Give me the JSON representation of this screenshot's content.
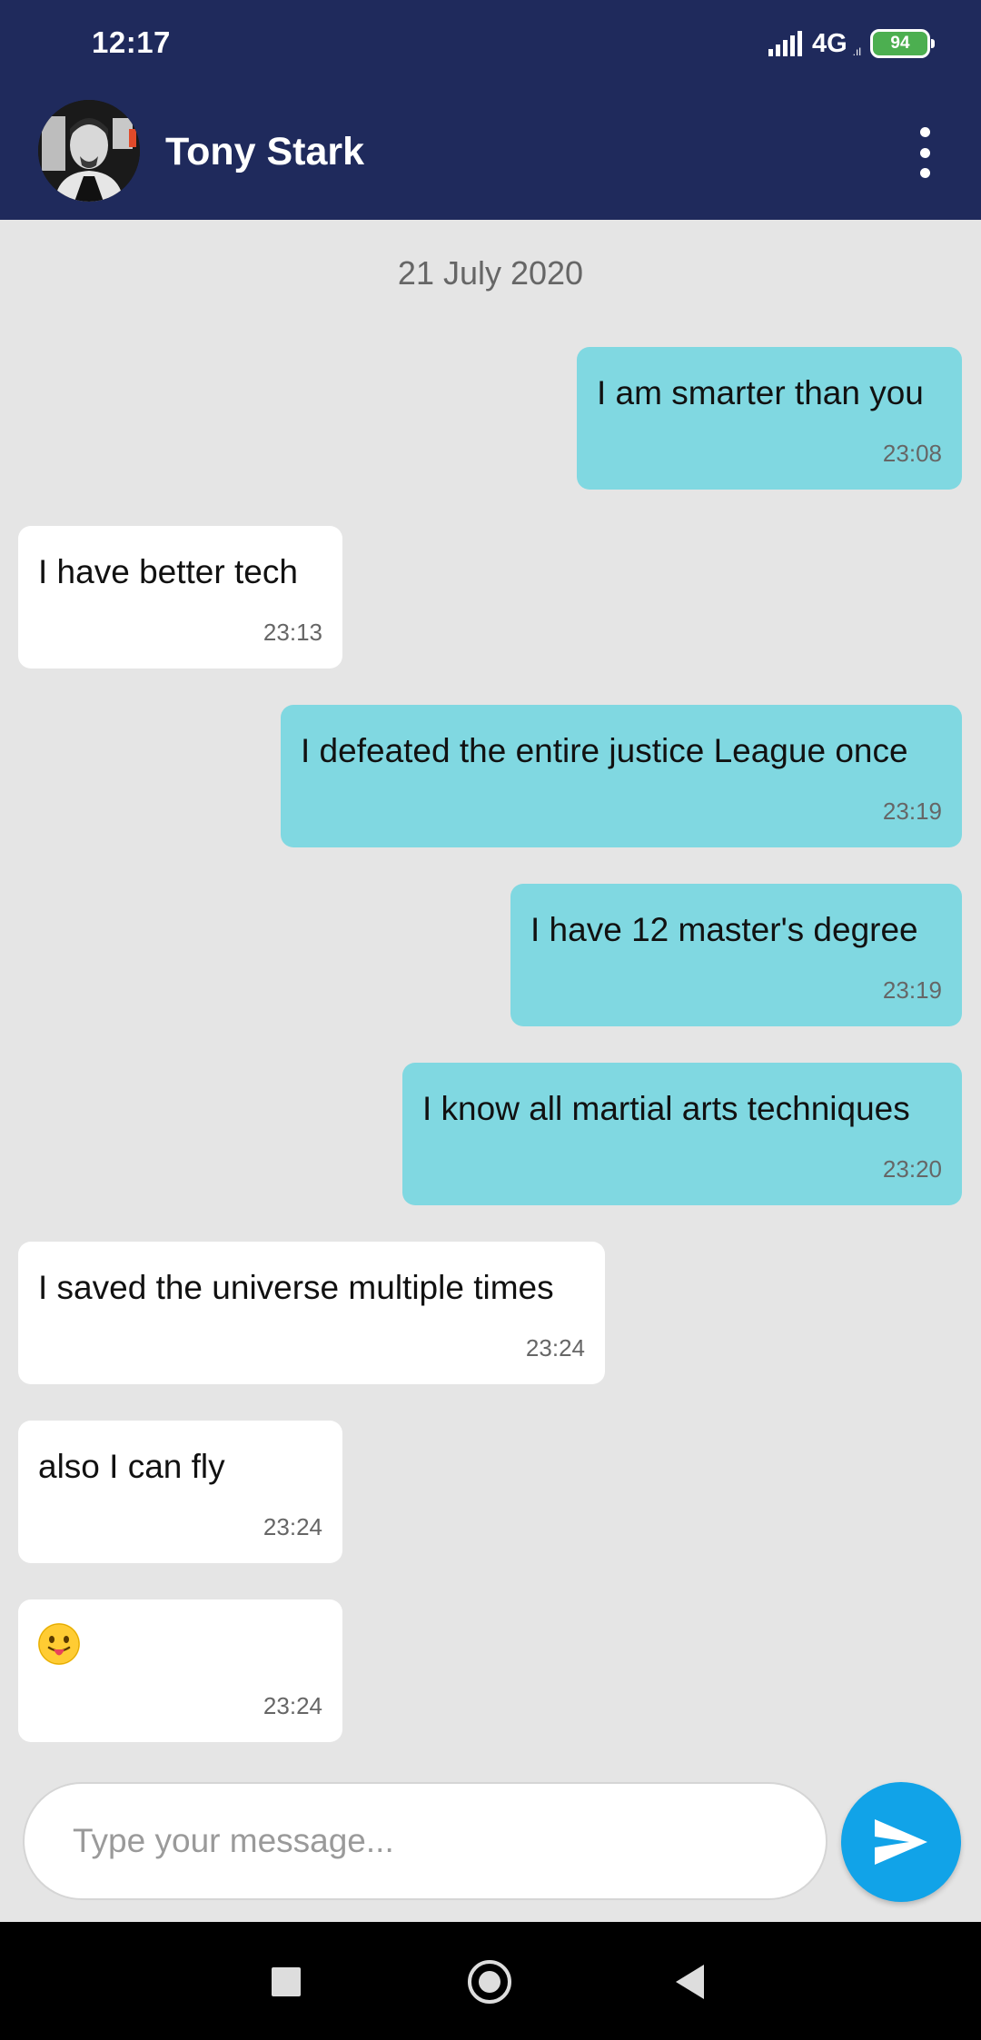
{
  "status_bar": {
    "time": "12:17",
    "network": "4G",
    "network_sub": ".ıl",
    "battery": "94"
  },
  "header": {
    "contact_name": "Tony Stark",
    "avatar_icon": "avatar-photo",
    "menu_icon": "more-vertical-icon"
  },
  "chat": {
    "date_label": "21 July 2020",
    "messages": [
      {
        "direction": "sent",
        "text": "I am smarter than you",
        "time": "23:08"
      },
      {
        "direction": "received",
        "text": "I have better tech",
        "time": "23:13"
      },
      {
        "direction": "sent",
        "text": "I defeated the entire justice League once",
        "time": "23:19"
      },
      {
        "direction": "sent",
        "text": "I have 12 master's degree",
        "time": "23:19"
      },
      {
        "direction": "sent",
        "text": "I know all martial arts techniques",
        "time": "23:20"
      },
      {
        "direction": "received",
        "text": "I saved the universe multiple times",
        "time": "23:24"
      },
      {
        "direction": "received",
        "text": "also I can fly",
        "time": "23:24"
      },
      {
        "direction": "received",
        "text": "",
        "emoji": "tongue-out-emoji",
        "time": "23:24"
      }
    ]
  },
  "composer": {
    "placeholder": "Type your message...",
    "value": "",
    "send_icon": "send-icon"
  },
  "colors": {
    "header": "#1f2a5c",
    "sent_bubble": "#80d8e1",
    "received_bubble": "#ffffff",
    "background": "#e5e5e5",
    "send_button": "#11a3e8"
  }
}
